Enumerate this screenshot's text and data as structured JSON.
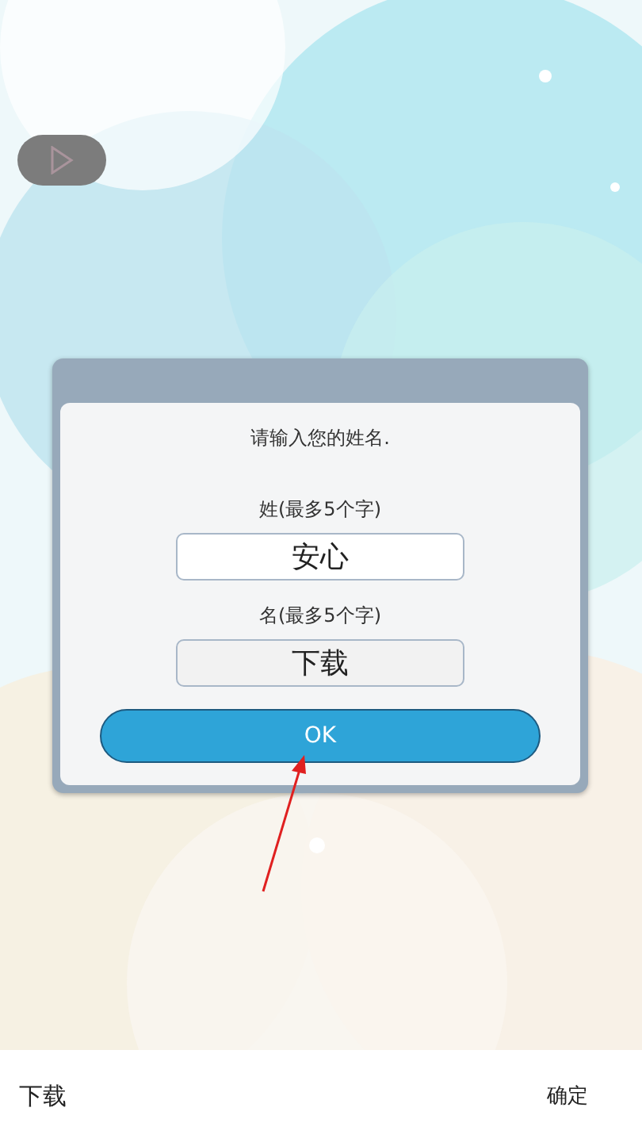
{
  "dialog": {
    "prompt": "请输入您的姓名.",
    "fields": [
      {
        "label": "姓(最多5个字)",
        "value": "安心",
        "focused": false
      },
      {
        "label": "名(最多5个字)",
        "value": "下载",
        "focused": true
      }
    ],
    "ok_button": "OK"
  },
  "input_bar": {
    "value": "下载",
    "confirm": "确定"
  }
}
